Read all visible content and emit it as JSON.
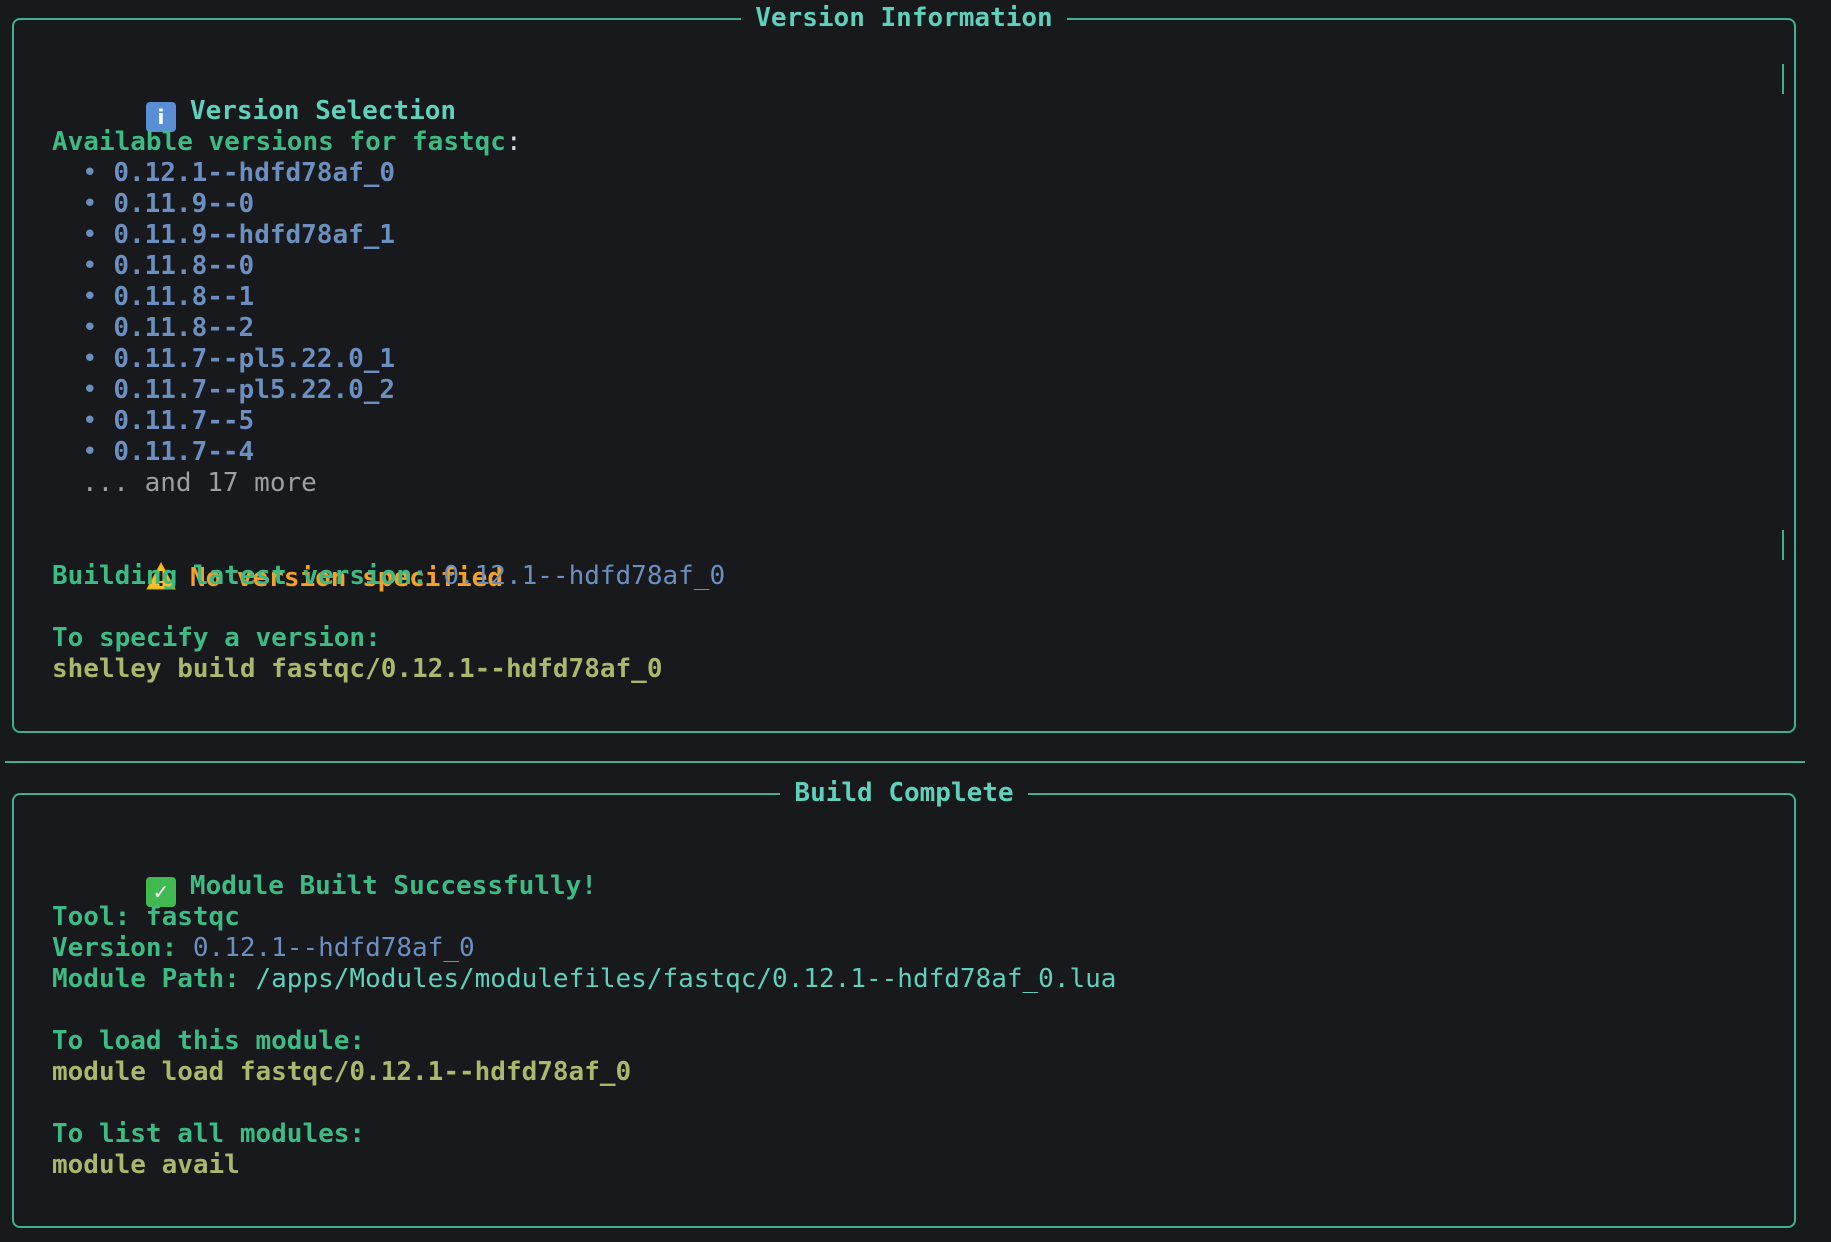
{
  "version_panel": {
    "title": "Version Information",
    "heading": "Version Selection",
    "heading_icon": "info-icon",
    "available_label": "Available versions for fastqc",
    "available_colon": ":",
    "bullet": "•",
    "versions": [
      "0.12.1--hdfd78af_0",
      "0.11.9--0",
      "0.11.9--hdfd78af_1",
      "0.11.8--0",
      "0.11.8--1",
      "0.11.8--2",
      "0.11.7--pl5.22.0_1",
      "0.11.7--pl5.22.0_2",
      "0.11.7--5",
      "0.11.7--4"
    ],
    "more_text": "... and 17 more",
    "warning_icon": "warning-icon",
    "warning_text": "No version specified",
    "building_label": "Building latest version: ",
    "building_version": "0.12.1--hdfd78af_0",
    "specify_label": "To specify a version:",
    "specify_command": "shelley build fastqc/0.12.1--hdfd78af_0"
  },
  "build_panel": {
    "title": "Build Complete",
    "heading_icon": "check-icon",
    "heading": "Module Built Successfully!",
    "tool_label": "Tool: ",
    "tool_value": "fastqc",
    "version_label": "Version: ",
    "version_value": "0.12.1--hdfd78af_0",
    "path_label": "Module Path: ",
    "path_value": "/apps/Modules/modulefiles/fastqc/0.12.1--hdfd78af_0.lua",
    "load_label": "To load this module:",
    "load_command": "module load fastqc/0.12.1--hdfd78af_0",
    "list_label": "To list all modules:",
    "list_command": "module avail"
  },
  "colors": {
    "background": "#17191c",
    "border": "#3fae93",
    "title": "#5fd1ba",
    "label_green": "#3dbb84",
    "version_blue": "#6b8fbf",
    "command_olive": "#a9b86c",
    "warning_orange": "#f5a02a",
    "muted_gray": "#9aa0a6"
  }
}
